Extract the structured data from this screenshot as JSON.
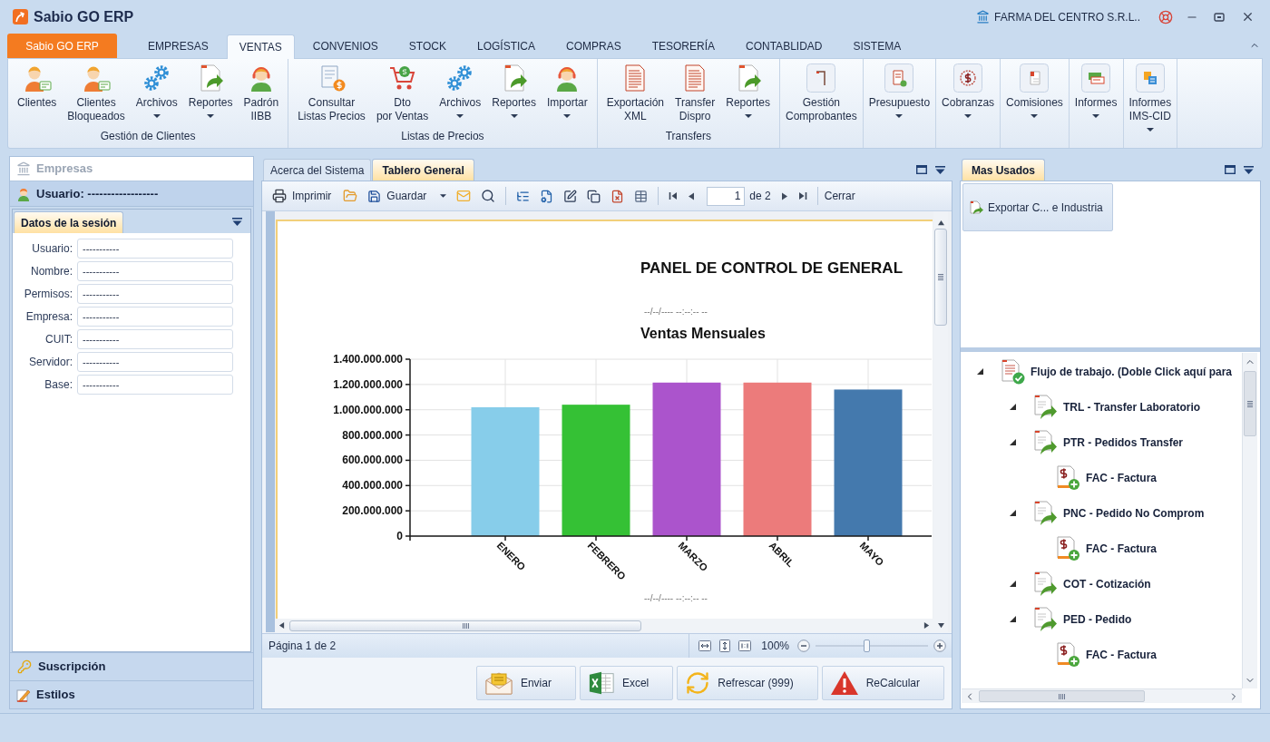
{
  "window": {
    "title": "Sabio GO ERP",
    "company": "FARMA DEL CENTRO S.R.L.."
  },
  "ribbon_tabs": {
    "app_button": "Sabio GO ERP",
    "tabs": [
      {
        "label": "EMPRESAS",
        "selected": false
      },
      {
        "label": "VENTAS",
        "selected": true
      },
      {
        "label": "CONVENIOS",
        "selected": false
      },
      {
        "label": "STOCK",
        "selected": false
      },
      {
        "label": "LOGÍSTICA",
        "selected": false
      },
      {
        "label": "COMPRAS",
        "selected": false
      },
      {
        "label": "TESORERÍA",
        "selected": false
      },
      {
        "label": "CONTABLIDAD",
        "selected": false
      },
      {
        "label": "SISTEMA",
        "selected": false
      }
    ]
  },
  "ribbon_groups": [
    {
      "label": "Gestión de Clientes",
      "items": [
        {
          "label": "Clientes",
          "kind": "client",
          "dropdown": false
        },
        {
          "label": "Clientes\nBloqueados",
          "kind": "client",
          "dropdown": false
        },
        {
          "label": "Archivos",
          "kind": "gears",
          "dropdown": true
        },
        {
          "label": "Reportes",
          "kind": "report",
          "dropdown": true
        },
        {
          "label": "Padrón\nIIBB",
          "kind": "agent",
          "dropdown": false
        }
      ]
    },
    {
      "label": "Listas de Precios",
      "items": [
        {
          "label": "Consultar\nListas Precios",
          "kind": "pricelist",
          "dropdown": false
        },
        {
          "label": "Dto\npor Ventas",
          "kind": "cart",
          "dropdown": false
        },
        {
          "label": "Archivos",
          "kind": "gears",
          "dropdown": true
        },
        {
          "label": "Reportes",
          "kind": "report",
          "dropdown": true
        },
        {
          "label": "Importar",
          "kind": "agent",
          "dropdown": true
        }
      ]
    },
    {
      "label": "Transfers",
      "items": [
        {
          "label": "Exportación\nXML",
          "kind": "sheet",
          "dropdown": false
        },
        {
          "label": "Transfer\nDispro",
          "kind": "sheet",
          "dropdown": false
        },
        {
          "label": "Reportes",
          "kind": "report",
          "dropdown": true
        }
      ]
    },
    {
      "items": [
        {
          "label": "Gestión\nComprobantes",
          "kind": "corner",
          "dropdown": false
        }
      ]
    },
    {
      "items": [
        {
          "label": "Presupuesto",
          "kind": "budget",
          "dropdown": true
        }
      ]
    },
    {
      "items": [
        {
          "label": "Cobranzas",
          "kind": "dollar",
          "dropdown": true
        }
      ]
    },
    {
      "items": [
        {
          "label": "Comisiones",
          "kind": "flag",
          "dropdown": true
        }
      ]
    },
    {
      "items": [
        {
          "label": "Informes",
          "kind": "cash",
          "dropdown": true
        }
      ]
    },
    {
      "items": [
        {
          "label": "Informes\nIMS-CID",
          "kind": "ims",
          "dropdown": true
        }
      ]
    }
  ],
  "left_panel": {
    "sections": [
      {
        "label": "Empresas",
        "kind": "company",
        "disabled": true,
        "expanded": false
      },
      {
        "label": "Usuario: ------------------",
        "kind": "user",
        "disabled": false,
        "expanded": true
      },
      {
        "label": "Suscripción",
        "kind": "key",
        "disabled": false,
        "expanded": false
      },
      {
        "label": "Estilos",
        "kind": "style",
        "disabled": false,
        "expanded": false
      }
    ],
    "session": {
      "tabs": [
        {
          "label": "Datos de la sesión",
          "selected": true
        }
      ],
      "fields": [
        {
          "label": "Usuario:",
          "value": "-----------"
        },
        {
          "label": "Nombre:",
          "value": "-----------"
        },
        {
          "label": "Permisos:",
          "value": "-----------"
        },
        {
          "label": "Empresa:",
          "value": "-----------"
        },
        {
          "label": "CUIT:",
          "value": "-----------"
        },
        {
          "label": "Servidor:",
          "value": "-----------"
        },
        {
          "label": "Base:",
          "value": "-----------"
        }
      ]
    }
  },
  "document_tabs": [
    {
      "label": "Acerca del Sistema",
      "selected": false
    },
    {
      "label": "Tablero General",
      "selected": true
    }
  ],
  "toolbar": {
    "print": "Imprimir",
    "save": "Guardar",
    "page": "1",
    "page_count": "de 2",
    "close": "Cerrar"
  },
  "report": {
    "title": "PANEL DE CONTROL DE GENERAL",
    "date_top": "--/--/---- --:--:-- --",
    "chart_data": {
      "type": "bar",
      "title": "Ventas Mensuales",
      "categories": [
        "ENERO",
        "FEBRERO",
        "MARZO",
        "ABRIL",
        "MAYO"
      ],
      "values": [
        1020000000,
        1040000000,
        1215000000,
        1215000000,
        1160000000
      ],
      "colors": [
        "#87cdea",
        "#35c135",
        "#ab54cc",
        "#ec7b7b",
        "#4479ad"
      ],
      "grid": true,
      "ylim": [
        0,
        1400000000
      ],
      "yticks": [
        {
          "value": 0,
          "label": "0"
        },
        {
          "value": 200000000,
          "label": "200.000.000"
        },
        {
          "value": 400000000,
          "label": "400.000.000"
        },
        {
          "value": 600000000,
          "label": "600.000.000"
        },
        {
          "value": 800000000,
          "label": "800.000.000"
        },
        {
          "value": 1000000000,
          "label": "1.000.000.000"
        },
        {
          "value": 1200000000,
          "label": "1.200.000.000"
        },
        {
          "value": 1400000000,
          "label": "1.400.000.000"
        }
      ]
    },
    "date_bottom": "--/--/---- --:--:-- --"
  },
  "viewer_status": {
    "page_info": "Página 1 de 2",
    "zoom": "100%",
    "level": 0.45
  },
  "actions": [
    {
      "label": "Enviar",
      "kind": "mail"
    },
    {
      "label": "Excel",
      "kind": "excel"
    },
    {
      "label": "Refrescar (999)",
      "kind": "refresh"
    },
    {
      "label": "ReCalcular",
      "kind": "warning"
    }
  ],
  "right_panel": {
    "tabs": [
      {
        "label": "Mas Usados",
        "selected": true
      }
    ],
    "shortcuts": [
      {
        "label": "Exportar C... e Industria"
      }
    ],
    "workflow": [
      {
        "label": "Flujo de trabajo. (Doble Click aquí para",
        "expanded": true,
        "children": [
          {
            "label": "TRL - Transfer Laboratorio",
            "expanded": true
          },
          {
            "label": "PTR - Pedidos Transfer",
            "expanded": true,
            "children": [
              {
                "label": "FAC - Factura"
              }
            ]
          },
          {
            "label": "PNC - Pedido No Comprom",
            "expanded": true,
            "children": [
              {
                "label": "FAC - Factura"
              }
            ]
          },
          {
            "label": "COT - Cotización",
            "expanded": true
          },
          {
            "label": "PED - Pedido",
            "expanded": true,
            "children": [
              {
                "label": "FAC - Factura"
              }
            ]
          }
        ]
      }
    ]
  }
}
